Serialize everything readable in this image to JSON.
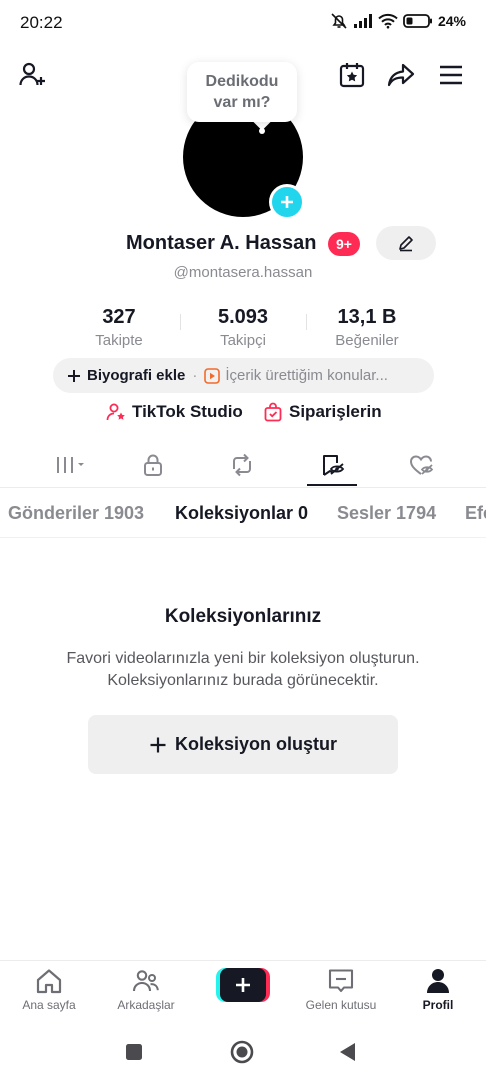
{
  "status_bar": {
    "time": "20:22",
    "battery": "24%"
  },
  "bubble": {
    "line1": "Dedikodu",
    "line2": "var mı?"
  },
  "profile": {
    "display_name": "Montaser A. Hassan",
    "badge": "9+",
    "username": "@montasera.hassan"
  },
  "stats": [
    {
      "value": "327",
      "label": "Takipte"
    },
    {
      "value": "5.093",
      "label": "Takipçi"
    },
    {
      "value": "13,1 B",
      "label": "Beğeniler"
    }
  ],
  "bio": {
    "add_label": "Biyografi ekle",
    "separator": "·",
    "content_label": "İçerik ürettiğim konular..."
  },
  "links": {
    "studio": "TikTok Studio",
    "orders": "Siparişlerin"
  },
  "content_tabs": [
    {
      "label": "Gönderiler 1903"
    },
    {
      "label": "Koleksiyonlar 0"
    },
    {
      "label": "Sesler 1794"
    },
    {
      "label": "Efe"
    }
  ],
  "empty_state": {
    "title": "Koleksiyonlarınız",
    "line1": "Favori videolarınızla yeni bir koleksiyon oluşturun.",
    "line2": "Koleksiyonlarınız burada görünecektir.",
    "button": "Koleksiyon oluştur"
  },
  "bottom_nav": [
    {
      "label": "Ana sayfa",
      "icon": "home-icon"
    },
    {
      "label": "Arkadaşlar",
      "icon": "friends-icon"
    },
    {
      "label": "",
      "icon": "create-plus-icon"
    },
    {
      "label": "Gelen kutusu",
      "icon": "inbox-icon"
    },
    {
      "label": "Profil",
      "icon": "profile-icon"
    }
  ],
  "colors": {
    "accent": "#fe2c55",
    "cyan": "#25f4ee",
    "avatar_plus": "#20d5ec",
    "text": "#161823",
    "muted": "#8a8b91"
  }
}
